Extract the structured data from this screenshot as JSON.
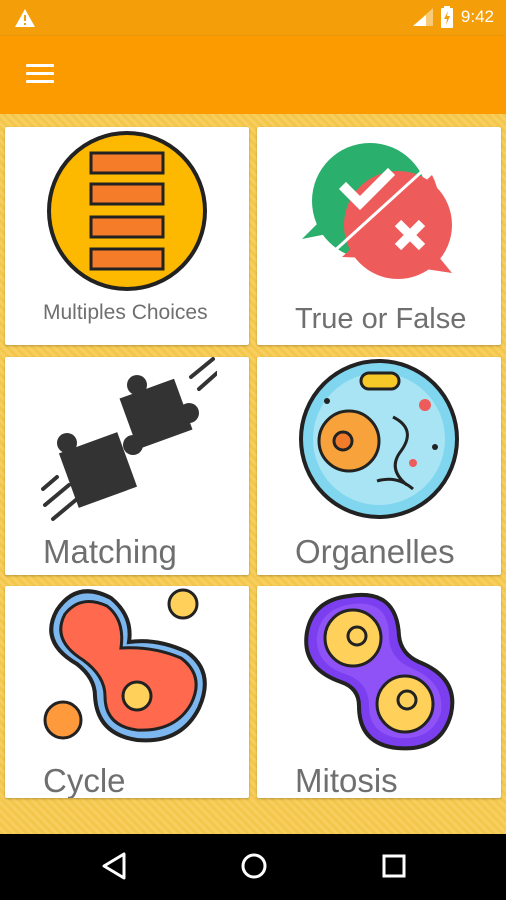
{
  "status_bar": {
    "time": "9:42",
    "icons": [
      "warning-icon",
      "signal-icon",
      "battery-charging-icon"
    ]
  },
  "app_bar": {
    "menu_icon": "hamburger-menu-icon",
    "accent": "#fb9b00"
  },
  "tiles": [
    {
      "label": "Multiples Choices",
      "icon": "multiple-choice-list-icon"
    },
    {
      "label": "True or False",
      "icon": "check-cross-chat-bubbles-icon"
    },
    {
      "label": "Matching",
      "icon": "puzzle-pieces-icon"
    },
    {
      "label": "Organelles",
      "icon": "cell-organelles-icon"
    },
    {
      "label": "Cycle",
      "icon": "cell-cycle-icon"
    },
    {
      "label": "Mitosis",
      "icon": "mitosis-dividing-cell-icon"
    }
  ],
  "nav_bar": {
    "buttons": [
      "back-icon",
      "home-icon",
      "recents-icon"
    ]
  },
  "colors": {
    "status_bar": "#f49e0a",
    "background": "#f3c64a",
    "card": "#ffffff",
    "label": "#6f6f6f"
  }
}
